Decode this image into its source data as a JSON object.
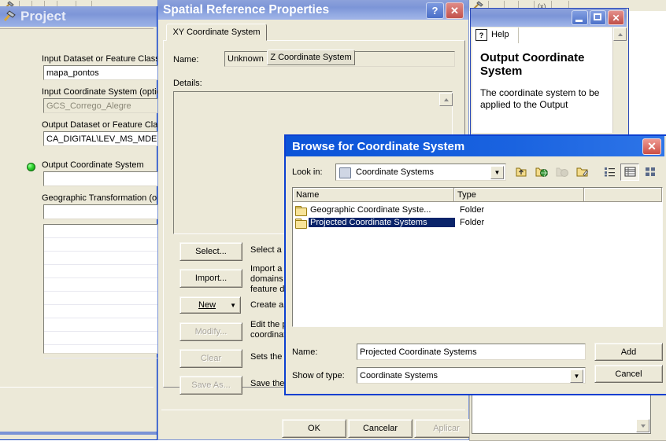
{
  "background": {
    "toolbar_hint": "arcmap-toolbar"
  },
  "project_dialog": {
    "title": "Project",
    "icon": "hammer-tool-icon",
    "fields": [
      {
        "label": "Input Dataset or Feature Class",
        "value": "mapa_pontos",
        "readonly": false
      },
      {
        "label": "Input Coordinate System (optional)",
        "value": "GCS_Corrego_Alegre",
        "readonly": true
      },
      {
        "label": "Output Dataset or Feature Class",
        "value": "CA_DIGITAL\\LEV_MS_MDE",
        "readonly": false
      },
      {
        "label": "Output Coordinate System",
        "value": "",
        "readonly": false,
        "required": true
      },
      {
        "label": "Geographic Transformation (optional)",
        "value": "",
        "readonly": false
      }
    ]
  },
  "spatial_reference_dialog": {
    "title": "Spatial Reference Properties",
    "help_button": "?",
    "close_button": "✕",
    "tabs": [
      {
        "label": "XY Coordinate System",
        "active": true
      },
      {
        "label": "Z Coordinate System",
        "active": false
      }
    ],
    "name_label": "Name:",
    "name_value": "Unknown",
    "details_label": "Details:",
    "details_value": "",
    "buttons": [
      {
        "label": "Select...",
        "disabled": false,
        "description": "Select a predefined coordinate system."
      },
      {
        "label": "Import...",
        "disabled": false,
        "description": "Import a coordinate system and X/Y, Z and M\ndomains from an existing geodataset (e.g.,\nfeature dataset, feature class, raster)."
      },
      {
        "label": "New",
        "disabled": false,
        "dropdown": true,
        "description": "Create a new coordinate system."
      },
      {
        "label": "Modify...",
        "disabled": true,
        "description": "Edit the properties of the currently selected\ncoordinate system."
      },
      {
        "label": "Clear",
        "disabled": true,
        "description": "Sets the coordinate system to Unknown."
      },
      {
        "label": "Save As...",
        "disabled": true,
        "description": "Save the coordinate system to a file."
      }
    ],
    "footer_buttons": [
      {
        "label": "OK",
        "disabled": false
      },
      {
        "label": "Cancelar",
        "disabled": false
      },
      {
        "label": "Aplicar",
        "disabled": true
      }
    ]
  },
  "help_window": {
    "minimize": "–",
    "maximize": "□",
    "close": "✕",
    "tab_label": "Help",
    "tab_icon": "help-question-icon",
    "heading": "Output Coordinate System",
    "body": "The coordinate system to be applied to the Output",
    "scroll_up": "▲",
    "scroll_down": "▼"
  },
  "browse_dialog": {
    "title": "Browse for Coordinate System",
    "close_button": "✕",
    "look_in_label": "Look in:",
    "look_in_value": "Coordinate Systems",
    "look_in_icon": "coordinate-systems-folder-icon",
    "toolbar": [
      {
        "name": "up-one-level-icon"
      },
      {
        "name": "connect-to-folder-icon"
      },
      {
        "name": "disconnect-folder-icon",
        "disabled": true
      },
      {
        "name": "new-folder-icon"
      },
      {
        "name": "list-view-icon"
      },
      {
        "name": "details-view-icon",
        "active": true
      },
      {
        "name": "thumbnails-view-icon"
      }
    ],
    "columns": [
      "Name",
      "Type",
      ""
    ],
    "rows": [
      {
        "name": "Geographic Coordinate Syste...",
        "type": "Folder",
        "selected": false
      },
      {
        "name": "Projected Coordinate Systems",
        "type": "Folder",
        "selected": true
      }
    ],
    "name_label": "Name:",
    "name_value": "Projected Coordinate Systems",
    "show_of_type_label": "Show of type:",
    "show_of_type_value": "Coordinate Systems",
    "add_button": "Add",
    "cancel_button": "Cancel"
  },
  "colors": {
    "dialog_face": "#ece9d8",
    "active_title": "#0b53d8",
    "inactive_title": "#7c95d7",
    "selection": "#0a246a",
    "required_dot": "#31d431"
  }
}
